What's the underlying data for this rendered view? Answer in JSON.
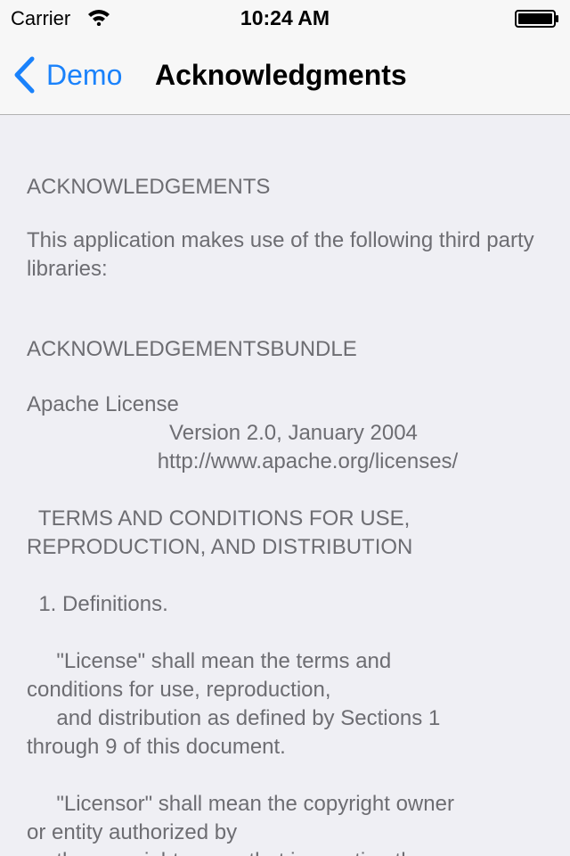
{
  "status_bar": {
    "carrier": "Carrier",
    "time": "10:24 AM"
  },
  "nav": {
    "back_label": "Demo",
    "title": "Acknowledgments"
  },
  "content": {
    "heading": "ACKNOWLEDGEMENTS",
    "intro": "This application makes use of the following third party libraries:",
    "library_heading": "ACKNOWLEDGEMENTSBUNDLE",
    "license_text": "Apache License\n                        Version 2.0, January 2004\n                      http://www.apache.org/licenses/\n\n  TERMS AND CONDITIONS FOR USE,\nREPRODUCTION, AND DISTRIBUTION\n\n  1. Definitions.\n\n     \"License\" shall mean the terms and\nconditions for use, reproduction,\n     and distribution as defined by Sections 1\nthrough 9 of this document.\n\n     \"Licensor\" shall mean the copyright owner\nor entity authorized by\n     the copyright owner that is granting the"
  },
  "colors": {
    "accent": "#1a82fb",
    "background": "#efeff4",
    "text": "#6d6d72"
  }
}
